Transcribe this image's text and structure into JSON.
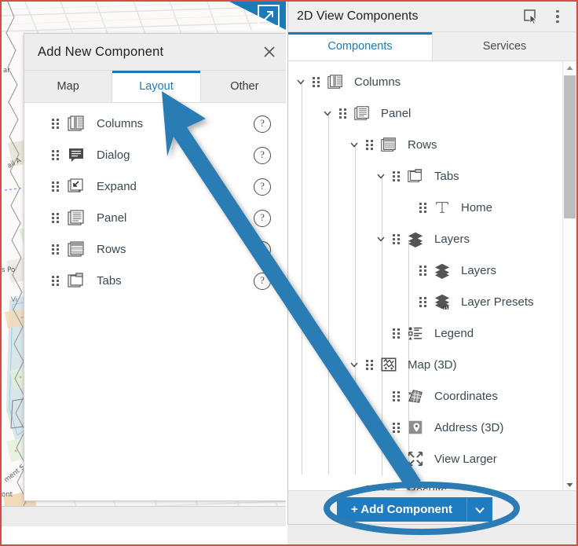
{
  "left_app": {
    "expand_icon": "expand-arrow-icon",
    "map_labels": [
      "ar",
      "ail A",
      "s Po",
      "Vi",
      "ment S",
      "ont"
    ]
  },
  "dialog": {
    "title": "Add New Component",
    "close_label": "✕",
    "tabs": [
      {
        "label": "Map",
        "active": false
      },
      {
        "label": "Layout",
        "active": true
      },
      {
        "label": "Other",
        "active": false
      }
    ],
    "help_label": "?",
    "items": [
      {
        "label": "Columns",
        "icon": "columns-icon"
      },
      {
        "label": "Dialog",
        "icon": "dialog-icon"
      },
      {
        "label": "Expand",
        "icon": "expand-icon"
      },
      {
        "label": "Panel",
        "icon": "panel-icon"
      },
      {
        "label": "Rows",
        "icon": "rows-icon"
      },
      {
        "label": "Tabs",
        "icon": "tabs-icon"
      }
    ]
  },
  "panel": {
    "title": "2D View Components",
    "header_icons": [
      "select-pointer-icon",
      "more-options-icon"
    ],
    "tabs": [
      {
        "label": "Components",
        "active": true
      },
      {
        "label": "Services",
        "active": false
      }
    ],
    "tree": [
      {
        "label": "Columns",
        "icon": "columns-icon",
        "depth": 0,
        "chevron": "down"
      },
      {
        "label": "Panel",
        "icon": "panel-icon",
        "depth": 1,
        "chevron": "down"
      },
      {
        "label": "Rows",
        "icon": "rows-icon",
        "depth": 2,
        "chevron": "down"
      },
      {
        "label": "Tabs",
        "icon": "tabs-icon",
        "depth": 3,
        "chevron": "down"
      },
      {
        "label": "Home",
        "icon": "text-t-icon",
        "depth": 4,
        "chevron": "none"
      },
      {
        "label": "Layers",
        "icon": "layers-icon",
        "depth": 4,
        "chevron": "down"
      },
      {
        "label": "Layers",
        "icon": "layers-icon",
        "depth": 5,
        "chevron": "none"
      },
      {
        "label": "Layer Presets",
        "icon": "layer-presets-icon",
        "depth": 5,
        "chevron": "none"
      },
      {
        "label": "Legend",
        "icon": "legend-icon",
        "depth": 4,
        "chevron": "none"
      },
      {
        "label": "Map (3D)",
        "icon": "map-3d-icon",
        "depth": 3,
        "chevron": "down"
      },
      {
        "label": "Coordinates",
        "icon": "coordinates-icon",
        "depth": 4,
        "chevron": "none"
      },
      {
        "label": "Address (3D)",
        "icon": "address-pin-icon",
        "depth": 4,
        "chevron": "none"
      },
      {
        "label": "View Larger",
        "icon": "view-larger-icon",
        "depth": 4,
        "chevron": "none"
      },
      {
        "label": "Results",
        "icon": "results-icon",
        "depth": 3,
        "chevron": "none"
      }
    ],
    "scrollbar": {
      "up_label": "▲",
      "down_label": "▼"
    },
    "footer": {
      "add_label": "+ Add Component",
      "dropdown_icon": "chevron-down-icon"
    }
  },
  "annotations": {
    "arrow_color": "#2b7cb5",
    "ellipse_color": "#2b7cb5",
    "frame_color": "#d94a4a"
  }
}
